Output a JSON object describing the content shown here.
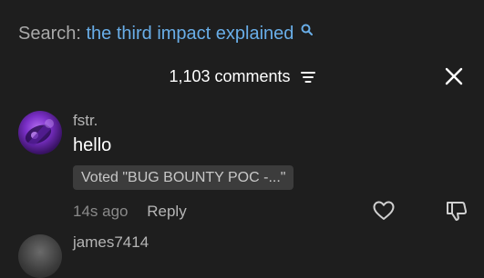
{
  "search": {
    "prefix": "Search:",
    "query": "the third impact explained",
    "icon": "search-icon"
  },
  "comments_header": {
    "count_label": "1,103 comments",
    "sort_icon": "sort-icon",
    "close_icon": "close-icon"
  },
  "comment": {
    "username": "fstr.",
    "text": "hello",
    "vote_badge": "Voted \"BUG BOUNTY POC -...\"",
    "timestamp": "14s ago",
    "reply_label": "Reply",
    "like_icon": "heart-icon",
    "dislike_icon": "thumbs-down-icon"
  },
  "next_comment": {
    "username": "james7414"
  },
  "colors": {
    "background": "#1e1e1e",
    "search_query": "#69aee8",
    "badge_bg": "#3c3c3c"
  }
}
